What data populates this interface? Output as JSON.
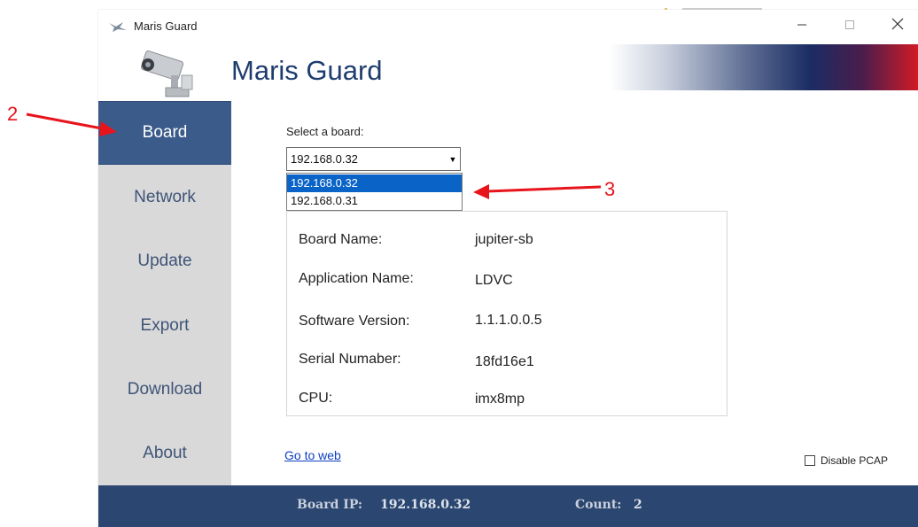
{
  "window": {
    "title": "Maris Guard",
    "header_title": "Maris Guard"
  },
  "sidebar": {
    "items": [
      {
        "label": "Board",
        "active": true
      },
      {
        "label": "Network",
        "active": false
      },
      {
        "label": "Update",
        "active": false
      },
      {
        "label": "Export",
        "active": false
      },
      {
        "label": "Download",
        "active": false
      },
      {
        "label": "About",
        "active": false
      }
    ]
  },
  "board_select": {
    "label": "Select a board:",
    "value": "192.168.0.32",
    "options": [
      "192.168.0.32",
      "192.168.0.31"
    ]
  },
  "info": {
    "rows": [
      {
        "label": "Board Name:",
        "value": "jupiter-sb"
      },
      {
        "label": "Application Name:",
        "value": "LDVC"
      },
      {
        "label": "Software Version:",
        "value": "1.1.1.0.0.5"
      },
      {
        "label": "Serial Numaber:",
        "value": "18fd16e1"
      },
      {
        "label": "CPU:",
        "value": "imx8mp"
      }
    ]
  },
  "link": {
    "label": "Go to web"
  },
  "pcap": {
    "label": "Disable PCAP",
    "checked": false
  },
  "status": {
    "board_ip_label": "Board IP:",
    "board_ip_value": "192.168.0.32",
    "count_label": "Count:",
    "count_value": "2"
  },
  "annotations": {
    "step_2": "2",
    "step_3": "3"
  },
  "colors": {
    "accent_blue": "#3b5b8a",
    "statusbar": "#2b4670",
    "annotation_red": "#e8141c",
    "selection": "#0a64c8"
  },
  "icons": [
    "camera-icon",
    "minimize-icon",
    "maximize-icon",
    "close-icon",
    "dropdown-arrow-icon"
  ]
}
